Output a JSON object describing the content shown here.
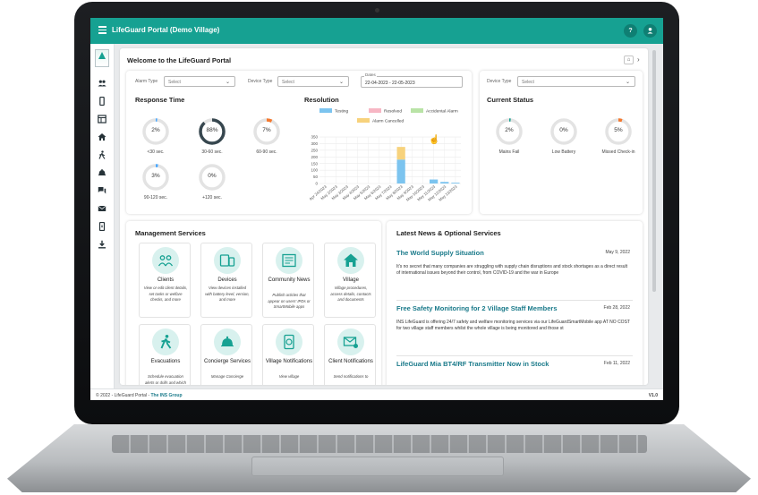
{
  "app": {
    "title": "LifeGuard Portal (Demo Village)",
    "help": "?"
  },
  "sidebar": {
    "icons": [
      "users-icon",
      "device-icon",
      "dashboard-icon",
      "home-icon",
      "walk-icon",
      "bell-icon",
      "chat-icon",
      "mail-icon",
      "phone-icon",
      "download-icon"
    ]
  },
  "header": {
    "welcome": "Welcome to the LifeGuard Portal"
  },
  "filters": {
    "alarm_type_label": "Alarm Type",
    "alarm_type_value": "Select",
    "device_type_label": "Device Type",
    "device_type_value": "Select",
    "dates_label": "Dates",
    "dates_value": "22-04-2023 - 22-05-2023"
  },
  "response_time": {
    "title": "Response Time",
    "gauges": [
      {
        "value": "2%",
        "label": "<30 sec.",
        "percent": 2,
        "color": "#4aa8ff"
      },
      {
        "value": "88%",
        "label": "30-60 sec.",
        "percent": 88,
        "color": "#37474f"
      },
      {
        "value": "7%",
        "label": "60-90 sec.",
        "percent": 7,
        "color": "#f4782d"
      },
      {
        "value": "3%",
        "label": "90-120 sec.",
        "percent": 3,
        "color": "#4aa8ff"
      },
      {
        "value": "0%",
        "label": "+120 sec.",
        "percent": 0,
        "color": "#4aa8ff"
      }
    ]
  },
  "resolution": {
    "title": "Resolution",
    "chart_data": {
      "type": "bar",
      "categories": [
        "Apr 24/2023",
        "May 2/2023",
        "May 3/2023",
        "May 4/2023",
        "May 5/2023",
        "May 6/2023",
        "May 7/2023",
        "May 8/2023",
        "May 9/2023",
        "May 10/2023",
        "May 11/2023",
        "May 12/2023",
        "May 13/2023"
      ],
      "series": [
        {
          "name": "Testing",
          "color": "#7cc4ef",
          "values": [
            0,
            0,
            0,
            0,
            0,
            0,
            0,
            180,
            0,
            0,
            30,
            12,
            6
          ]
        },
        {
          "name": "Resolved",
          "color": "#f7b6c4",
          "values": [
            0,
            0,
            0,
            0,
            0,
            0,
            0,
            0,
            0,
            0,
            0,
            0,
            0
          ]
        },
        {
          "name": "Accidental Alarm",
          "color": "#b9e3a6",
          "values": [
            0,
            0,
            0,
            0,
            0,
            0,
            0,
            0,
            0,
            0,
            0,
            0,
            0
          ]
        },
        {
          "name": "Alarm Cancelled",
          "color": "#f7d27c",
          "values": [
            0,
            0,
            0,
            0,
            0,
            0,
            0,
            95,
            0,
            0,
            0,
            0,
            0
          ]
        }
      ],
      "ylim": [
        0,
        350
      ],
      "yticks": [
        0,
        50,
        100,
        150,
        200,
        250,
        300,
        350
      ],
      "grid": true,
      "legend": "top"
    }
  },
  "current_status": {
    "device_type_label": "Device Type",
    "device_type_value": "Select",
    "title": "Current Status",
    "gauges": [
      {
        "value": "2%",
        "label": "Mains Fail",
        "percent": 2,
        "color": "#16a192"
      },
      {
        "value": "0%",
        "label": "Low Battery",
        "percent": 0,
        "color": "#16a192"
      },
      {
        "value": "5%",
        "label": "Missed Check-in",
        "percent": 5,
        "color": "#f4782d"
      }
    ]
  },
  "management": {
    "title": "Management Services",
    "services": [
      {
        "name": "Clients",
        "desc": "View or edit client details, set tasks or welfare checks, and more",
        "icon": "users-icon"
      },
      {
        "name": "Devices",
        "desc": "View devices installed with battery level, version, and more",
        "icon": "devices-icon"
      },
      {
        "name": "Community News",
        "desc": "Publish articles that appear on users' IPDs or SmartMobile apps",
        "icon": "news-icon"
      },
      {
        "name": "Village",
        "desc": "Village procedures, access details, contacts and documents",
        "icon": "village-icon"
      },
      {
        "name": "Evacuations",
        "desc": "Schedule evacuation alerts or drills and which residents viewed",
        "icon": "evacuation-icon"
      },
      {
        "name": "Concierge Services",
        "desc": "Manage Concierge",
        "icon": "concierge-icon"
      },
      {
        "name": "Village Notifications",
        "desc": "View village",
        "icon": "village-notification-icon"
      },
      {
        "name": "Client Notifications",
        "desc": "Send notifications to",
        "icon": "client-notification-icon"
      }
    ]
  },
  "news": {
    "title": "Latest News & Optional Services",
    "items": [
      {
        "title": "The World Supply Situation",
        "date": "May 9, 2022",
        "body": "It's no secret that many companies are struggling with supply chain disruptions and stock shortages as a direct result of international issues beyond their control, from COVID-19 and the war in Europe"
      },
      {
        "title": "Free Safety Monitoring for 2 Village Staff Members",
        "date": "Feb 28, 2022",
        "body": "INS LifeGuard is offering 24/7 safety and welfare monitoring services via our LifeGuardSmartMobile app AT NO COST for two village staff members whilst the whole village is being monitored and those st"
      },
      {
        "title": "LifeGuard Mia BT4/RF Transmitter Now in Stock",
        "date": "Feb 11, 2022",
        "body": ""
      }
    ]
  },
  "footer": {
    "copyright": "© 2022 - LifeGuard Portal - ",
    "brand": "The INS Group",
    "version": "V1.0"
  }
}
